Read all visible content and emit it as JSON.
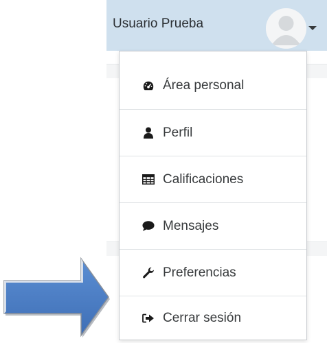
{
  "user_menu": {
    "user_name": "Usuario Prueba",
    "avatar_icon": "default-user-avatar",
    "toggle_icon": "caret-down-icon"
  },
  "dropdown": {
    "items": [
      {
        "label": "Área personal",
        "icon": "dashboard-icon"
      },
      {
        "label": "Perfil",
        "icon": "user-icon"
      },
      {
        "label": "Calificaciones",
        "icon": "table-icon"
      },
      {
        "label": "Mensajes",
        "icon": "comment-icon"
      },
      {
        "label": "Preferencias",
        "icon": "wrench-icon"
      },
      {
        "label": "Cerrar sesión",
        "icon": "sign-out-icon"
      }
    ]
  },
  "annotation": {
    "arrow_icon": "right-arrow-icon",
    "arrow_color": "#4a7dc4"
  },
  "colors": {
    "header_bg": "#cfe0ee",
    "icon_color": "#1a1a1a"
  }
}
